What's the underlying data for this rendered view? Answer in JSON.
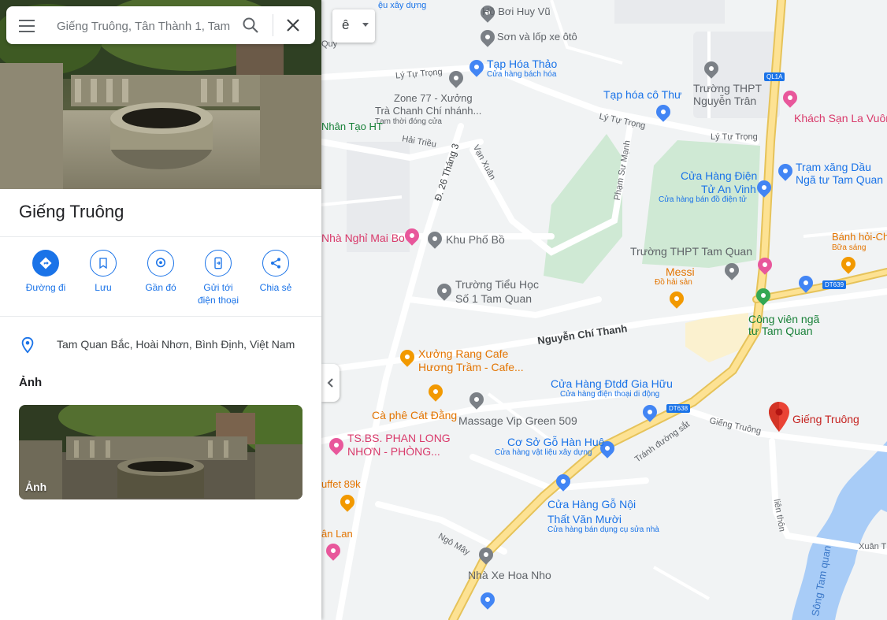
{
  "search": {
    "placeholder": "Giếng Truông, Tân Thành 1, Tam"
  },
  "language_button": "ê",
  "place": {
    "title": "Giếng Truông",
    "address": "Tam Quan Bắc, Hoài Nhơn, Bình Định, Việt Nam",
    "photos_heading": "Ảnh",
    "photo_label": "Ảnh"
  },
  "actions": [
    {
      "label": "Đường đi",
      "icon": "directions-icon"
    },
    {
      "label": "Lưu",
      "icon": "bookmark-icon"
    },
    {
      "label": "Gần đó",
      "icon": "nearby-icon"
    },
    {
      "label": "Gửi tới điện thoại",
      "icon": "send-to-phone-icon"
    },
    {
      "label": "Chia sẻ",
      "icon": "share-icon"
    }
  ],
  "colors": {
    "accent": "#1a73e8",
    "red_pin": "#ea4335",
    "highway": "#f8d36b",
    "park": "#c8e6c9",
    "water": "#a3ccff"
  },
  "map": {
    "selected_place": "Giếng Truông",
    "shields": [
      "QL1A",
      "DT639",
      "DT638"
    ],
    "roads": [
      "Lý Tự Trọng",
      "Lý Tự Trọng",
      "Lý Tự Trọng",
      "Hải Triều",
      "Đ. 26 Tháng 3",
      "Vạn Xuân",
      "Phạm Sư Mạnh",
      "Nguyễn Chí Thanh",
      "Giếng Truông",
      "Tránh đường sắt",
      "Ngô Mây",
      "liên thôn",
      "Xuân T"
    ],
    "water_labels": [
      "Sông Tam quan"
    ],
    "labels": [
      {
        "name": "Hồ Bơi Huy Vũ",
        "sub": "",
        "color": "#5f6368"
      },
      {
        "name": "Sơn và lốp xe ôtô",
        "sub": "",
        "color": "#5f6368"
      },
      {
        "name": "Tạp Hóa Thảo",
        "sub": "Cửa hàng bách hóa",
        "color": "#1a73e8"
      },
      {
        "name": "Zone 77 - Xưởng",
        "sub": "",
        "color": "#5f6368"
      },
      {
        "name": "Trà Chanh Chí nhánh...",
        "sub": "Tạm thời đóng cửa",
        "color": "#5f6368"
      },
      {
        "name": "Tạp hóa cô Thư",
        "sub": "",
        "color": "#1a73e8"
      },
      {
        "name": "Trường THPT",
        "sub": "",
        "color": "#5f6368"
      },
      {
        "name": "Nguyễn Trân",
        "sub": "",
        "color": "#5f6368"
      },
      {
        "name": "Khách Sạn La Vuông",
        "sub": "",
        "color": "#d93a6b"
      },
      {
        "name": "Nhân Tạo HT",
        "sub": "",
        "color": "#188038"
      },
      {
        "name": "Cửa Hàng Điện",
        "sub": "",
        "color": "#1a73e8"
      },
      {
        "name": "Tử An Vinh",
        "sub": "Cửa hàng bán đồ điện tử",
        "color": "#1a73e8"
      },
      {
        "name": "Trạm xăng Dầu",
        "sub": "",
        "color": "#1a73e8"
      },
      {
        "name": "Ngã tư Tam Quan",
        "sub": "",
        "color": "#1a73e8"
      },
      {
        "name": "Nhà Nghỉ Mai Bo",
        "sub": "",
        "color": "#d93a6b"
      },
      {
        "name": "Khu Phố Bồ",
        "sub": "",
        "color": "#5f6368"
      },
      {
        "name": "Bánh hỏi-Ch",
        "sub": "Bữa sáng",
        "color": "#e37400"
      },
      {
        "name": "Trường THPT Tam Quan",
        "sub": "",
        "color": "#5f6368"
      },
      {
        "name": "Messi",
        "sub": "Đồ hải sản",
        "color": "#e37400"
      },
      {
        "name": "Trường Tiểu Học",
        "sub": "",
        "color": "#5f6368"
      },
      {
        "name": "Số 1 Tam Quan",
        "sub": "",
        "color": "#5f6368"
      },
      {
        "name": "Công viên ngã",
        "sub": "",
        "color": "#188038"
      },
      {
        "name": "tư Tam Quan",
        "sub": "",
        "color": "#188038"
      },
      {
        "name": "Xưởng Rang Cafe",
        "sub": "",
        "color": "#e37400"
      },
      {
        "name": "Hương Trầm - Cafe...",
        "sub": "",
        "color": "#e37400"
      },
      {
        "name": "Cửa Hàng Đtdđ Gia Hữu",
        "sub": "Cửa hàng điện thoại di động",
        "color": "#1a73e8"
      },
      {
        "name": "Cà phê Cát Đằng",
        "sub": "",
        "color": "#e37400"
      },
      {
        "name": "Massage Vip Green 509",
        "sub": "",
        "color": "#5f6368"
      },
      {
        "name": "TS.BS. PHAN LONG",
        "sub": "",
        "color": "#d93a6b"
      },
      {
        "name": "NHƠN - PHÒNG...",
        "sub": "",
        "color": "#d93a6b"
      },
      {
        "name": "Cơ Sở Gỗ Hàn Huê",
        "sub": "Cửa hàng vật liệu xây dựng",
        "color": "#1a73e8"
      },
      {
        "name": "uffet 89k",
        "sub": "",
        "color": "#e37400"
      },
      {
        "name": "Cửa Hàng Gỗ Nội",
        "sub": "",
        "color": "#1a73e8"
      },
      {
        "name": "Thất Văn Mười",
        "sub": "Cửa hàng bán dụng cụ sửa nhà",
        "color": "#1a73e8"
      },
      {
        "name": "ân Lan",
        "sub": "",
        "color": "#e37400"
      },
      {
        "name": "Nhà Xe Hoa Nho",
        "sub": "",
        "color": "#5f6368"
      },
      {
        "name": "Giếng Truông",
        "sub": "",
        "color": "#c5221f"
      },
      {
        "name": "ệu xây dựng",
        "sub": "",
        "color": "#1a73e8"
      },
      {
        "name": "Quy",
        "sub": "",
        "color": "#5f6368"
      }
    ]
  }
}
